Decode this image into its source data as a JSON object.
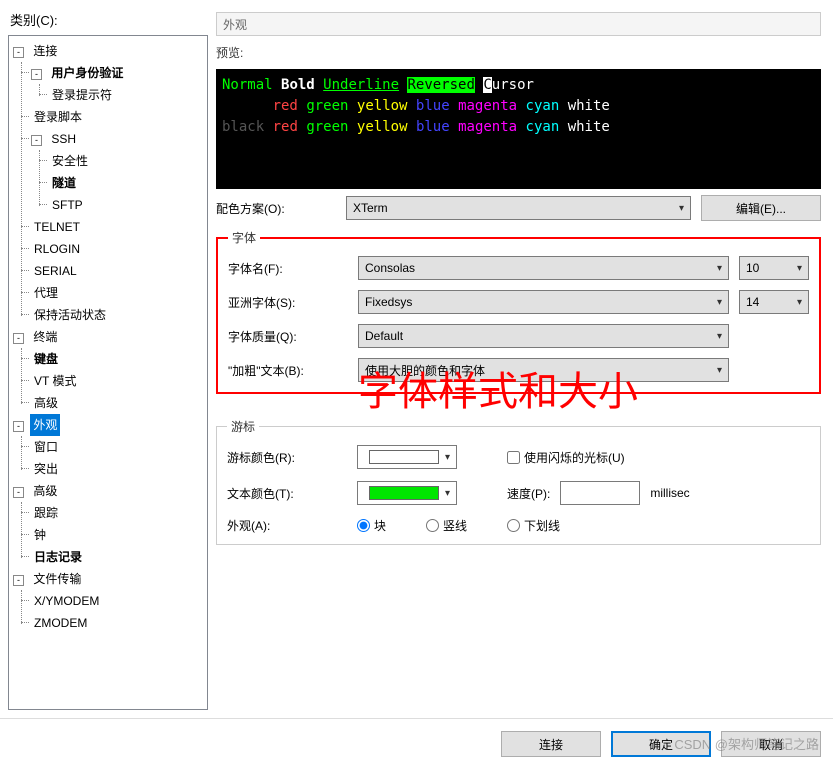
{
  "category_label": "类别(C):",
  "tree": {
    "connection": {
      "label": "连接",
      "expanded": true
    },
    "user_auth": {
      "label": "用户身份验证",
      "bold": true
    },
    "login_prompt": {
      "label": "登录提示符"
    },
    "login_script": {
      "label": "登录脚本"
    },
    "ssh": {
      "label": "SSH"
    },
    "security": {
      "label": "安全性"
    },
    "tunnel": {
      "label": "隧道",
      "bold": true
    },
    "sftp": {
      "label": "SFTP"
    },
    "telnet": {
      "label": "TELNET"
    },
    "rlogin": {
      "label": "RLOGIN"
    },
    "serial": {
      "label": "SERIAL"
    },
    "proxy": {
      "label": "代理"
    },
    "keepalive": {
      "label": "保持活动状态"
    },
    "terminal": {
      "label": "终端"
    },
    "keyboard": {
      "label": "键盘",
      "bold": true
    },
    "vtmode": {
      "label": "VT 模式"
    },
    "advanced": {
      "label": "高级"
    },
    "appearance": {
      "label": "外观",
      "selected": true
    },
    "window": {
      "label": "窗口"
    },
    "highlight": {
      "label": "突出"
    },
    "advanced2": {
      "label": "高级"
    },
    "trace": {
      "label": "跟踪"
    },
    "bell": {
      "label": "钟"
    },
    "logging": {
      "label": "日志记录",
      "bold": true
    },
    "filetransfer": {
      "label": "文件传输"
    },
    "xymodem": {
      "label": "X/YMODEM"
    },
    "zmodem": {
      "label": "ZMODEM"
    }
  },
  "header_section": "外观",
  "preview_label": "预览:",
  "preview": {
    "line1": {
      "normal": "Normal",
      "bold": "Bold",
      "underline": "Underline",
      "reversed": "Reversed",
      "cursor_c": "C",
      "cursor_rest": "ursor"
    },
    "line2": {
      "red": "red",
      "green": "green",
      "yellow": "yellow",
      "blue": "blue",
      "magenta": "magenta",
      "cyan": "cyan",
      "white": "white"
    },
    "line3": {
      "black": "black",
      "red": "red",
      "green": "green",
      "yellow": "yellow",
      "blue": "blue",
      "magenta": "magenta",
      "cyan": "cyan",
      "white": "white"
    }
  },
  "scheme": {
    "label": "配色方案(O):",
    "value": "XTerm",
    "edit_btn": "编辑(E)..."
  },
  "font_group": {
    "legend": "字体",
    "name": {
      "label": "字体名(F):",
      "value": "Consolas",
      "size": "10"
    },
    "asian": {
      "label": "亚洲字体(S):",
      "value": "Fixedsys",
      "size": "14"
    },
    "quality": {
      "label": "字体质量(Q):",
      "value": "Default"
    },
    "bold": {
      "label": "\"加粗\"文本(B):",
      "value": "使用大胆的颜色和字体"
    },
    "annotation": "字体样式和大小"
  },
  "cursor_group": {
    "legend": "游标",
    "color": {
      "label": "游标颜色(R):",
      "value": "#ffffff"
    },
    "text_color": {
      "label": "文本颜色(T):",
      "value": "#00e600"
    },
    "blink": {
      "label": "使用闪烁的光标(U)",
      "checked": false
    },
    "speed": {
      "label": "速度(P):",
      "value": "",
      "unit": "millisec"
    },
    "shape": {
      "label": "外观(A):",
      "options": {
        "block": "块",
        "vertical": "竖线",
        "underline": "下划线"
      },
      "selected": "block"
    }
  },
  "footer": {
    "connect": "连接",
    "ok": "确定",
    "cancel": "取消"
  },
  "watermark": "CSDN @架构师笔记之路"
}
